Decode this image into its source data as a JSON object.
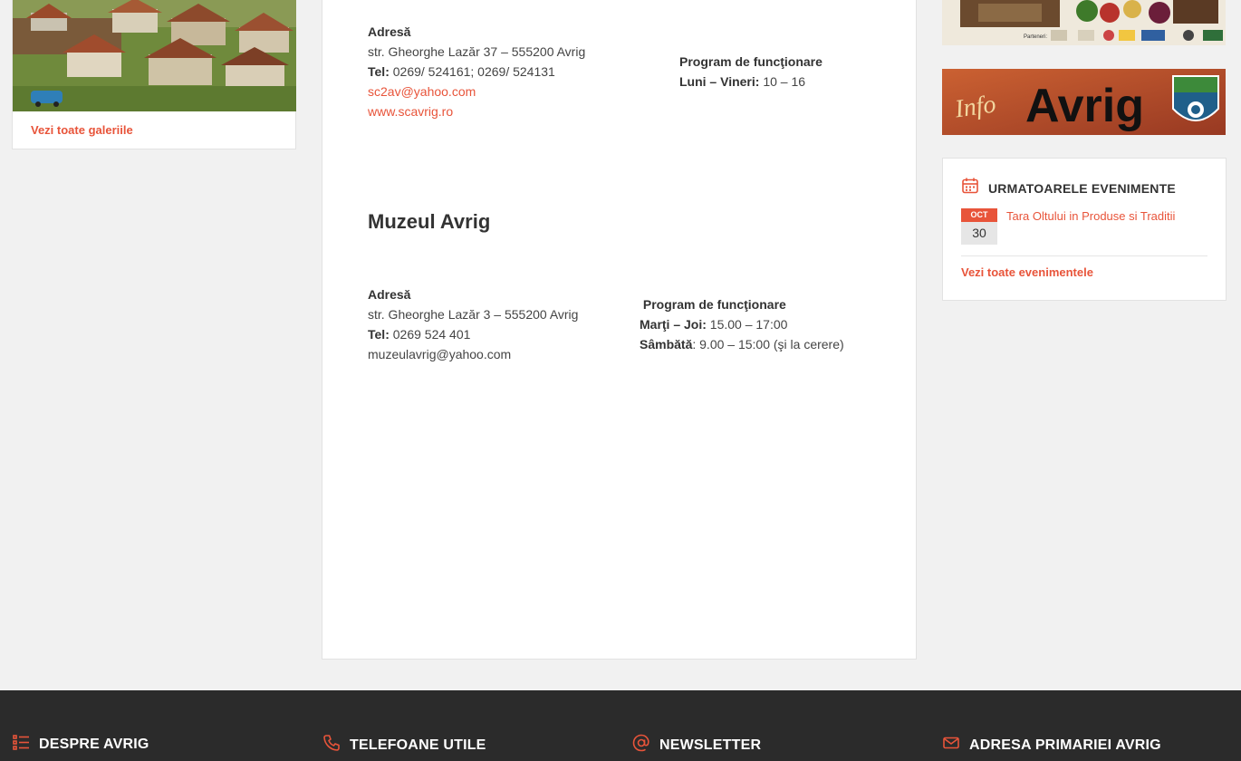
{
  "gallery": {
    "link_label": "Vezi toate galeriile"
  },
  "sca": {
    "address_label": "Adresă",
    "address": "str. Gheorghe Lazăr 37 – 555200 Avrig",
    "tel_label": "Tel:",
    "tel": " 0269/ 524161; 0269/ 524131",
    "email": "sc2av@yahoo.com",
    "website": "www.scavrig.ro",
    "hours_label": "Program de funcţionare",
    "days_label": "Luni – Vineri:",
    "hours": " 10 – 16"
  },
  "museum": {
    "title": "Muzeul Avrig",
    "address_label": "Adresă",
    "address": "str. Gheorghe Lazăr 3 – 555200 Avrig",
    "tel_label": "Tel:",
    "tel": " 0269 524 401",
    "email": "muzeulavrig@yahoo.com",
    "hours_label": "Program de funcţionare",
    "weekdays_label": "Marţi – Joi:",
    "weekdays_hours": " 15.00 – 17:00",
    "saturday_label": "Sâmbătă",
    "saturday_hours": ": 9.00 – 15:00 (şi la cerere)"
  },
  "banners": {
    "partners_label": "Parteneri:",
    "info_avrig_text_1": "Info",
    "info_avrig_text_2": "Avrig"
  },
  "events": {
    "title": "URMATOARELE EVENIMENTE",
    "items": [
      {
        "month": "OCT",
        "day": "30",
        "name": "Tara Oltului in Produse si Traditii"
      }
    ],
    "all_label": "Vezi toate evenimentele"
  },
  "footer": {
    "columns": [
      {
        "title": "DESPRE AVRIG",
        "icon": "list-icon"
      },
      {
        "title": "TELEFOANE UTILE",
        "icon": "phone-icon"
      },
      {
        "title": "NEWSLETTER",
        "icon": "at-icon"
      },
      {
        "title": "ADRESA PRIMARIEI AVRIG",
        "icon": "mail-icon"
      }
    ]
  },
  "colors": {
    "accent": "#e8543a",
    "footer_bg": "#2b2b2b",
    "page_bg": "#f1f1f1"
  }
}
